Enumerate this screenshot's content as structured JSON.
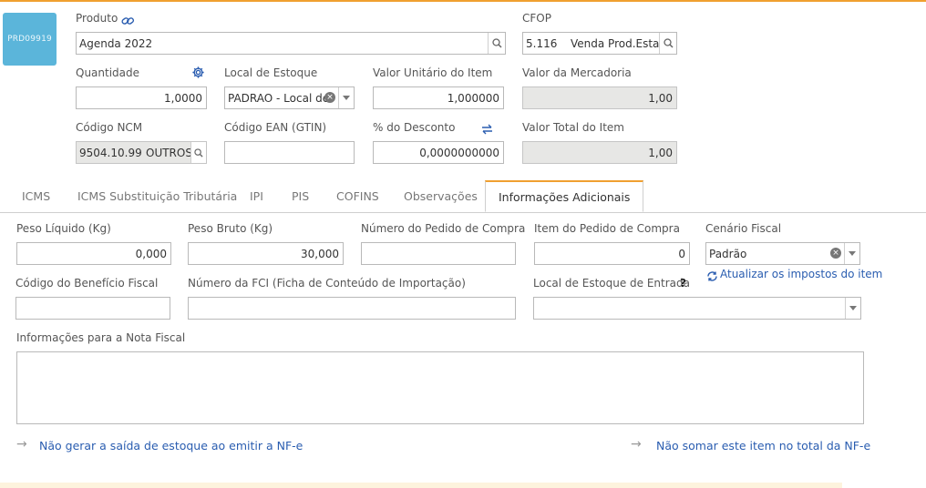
{
  "product": {
    "thumb_code": "PRD09919",
    "label": "Produto",
    "value": "Agenda 2022"
  },
  "cfop": {
    "label": "CFOP",
    "code": "5.116",
    "desc": "Venda Prod.Estab"
  },
  "quantidade": {
    "label": "Quantidade",
    "value": "1,0000"
  },
  "local_estoque": {
    "label": "Local de Estoque",
    "value": "PADRAO - Local de"
  },
  "valor_unitario": {
    "label": "Valor Unitário do Item",
    "value": "1,000000"
  },
  "valor_mercadoria": {
    "label": "Valor da Mercadoria",
    "value": "1,00"
  },
  "codigo_ncm": {
    "label": "Código NCM",
    "code": "9504.10.99",
    "desc": "OUTROS"
  },
  "codigo_ean": {
    "label": "Código EAN (GTIN)",
    "value": ""
  },
  "desconto": {
    "label": "% do Desconto",
    "value": "0,0000000000"
  },
  "valor_total": {
    "label": "Valor Total do Item",
    "value": "1,00"
  },
  "tabs": [
    {
      "label": "ICMS"
    },
    {
      "label": "ICMS Substituição Tributária"
    },
    {
      "label": "IPI"
    },
    {
      "label": "PIS"
    },
    {
      "label": "COFINS"
    },
    {
      "label": "Observações"
    },
    {
      "label": "Informações Adicionais",
      "active": true
    }
  ],
  "adicionais": {
    "peso_liquido": {
      "label": "Peso Líquido (Kg)",
      "value": "0,000"
    },
    "peso_bruto": {
      "label": "Peso Bruto (Kg)",
      "value": "30,000"
    },
    "numero_pedido": {
      "label": "Número do Pedido de Compra",
      "value": ""
    },
    "item_pedido": {
      "label": "Item do Pedido de Compra",
      "value": "0"
    },
    "cenario_fiscal": {
      "label": "Cenário Fiscal",
      "value": "Padrão"
    },
    "atualizar_link": "Atualizar os impostos do item",
    "codigo_beneficio": {
      "label": "Código do Benefício Fiscal",
      "value": ""
    },
    "numero_fci": {
      "label": "Número da FCI (Ficha de Conteúdo de Importação)",
      "value": ""
    },
    "local_entrada": {
      "label": "Local de Estoque de Entrada",
      "help": "?",
      "value": ""
    },
    "info_nf": {
      "label": "Informações para a Nota Fiscal",
      "value": ""
    },
    "link_nao_gerar": "Não gerar a saída de estoque ao emitir a NF-e",
    "link_nao_somar": "Não somar este item no total da NF-e"
  },
  "colors": {
    "accent": "#f0a030",
    "link": "#2a5db0",
    "thumb": "#5bb5da",
    "readonly": "#e7e7e5"
  }
}
